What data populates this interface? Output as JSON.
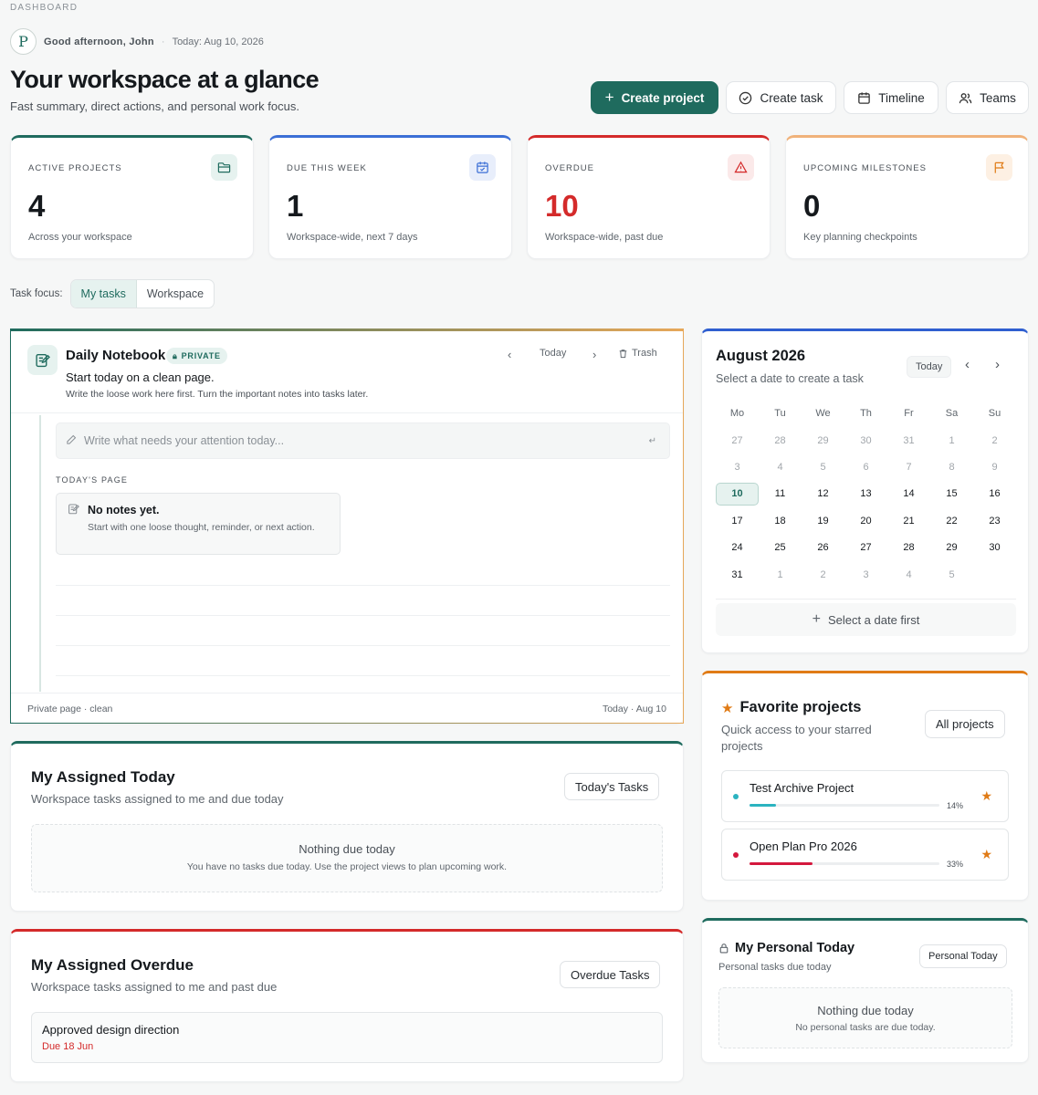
{
  "header": {
    "eyebrow": "DASHBOARD",
    "logo_letter": "P",
    "greeting": "Good afternoon, John",
    "separator": "·",
    "today": "Today: Aug 10, 2026",
    "title": "Your workspace at a glance",
    "subtitle": "Fast summary, direct actions, and personal work focus."
  },
  "actions": {
    "create_project": "Create project",
    "create_task": "Create task",
    "timeline": "Timeline",
    "teams": "Teams"
  },
  "stats": [
    {
      "label": "ACTIVE PROJECTS",
      "value": "4",
      "desc": "Across your workspace",
      "color": "#1f6b5e",
      "icon": "folder-icon"
    },
    {
      "label": "DUE THIS WEEK",
      "value": "1",
      "desc": "Workspace-wide, next 7 days",
      "color": "#3b6fd6",
      "icon": "calendar-check-icon"
    },
    {
      "label": "OVERDUE",
      "value": "10",
      "desc": "Workspace-wide, past due",
      "color": "#d42a2a",
      "icon": "alert-icon"
    },
    {
      "label": "UPCOMING MILESTONES",
      "value": "0",
      "desc": "Key planning checkpoints",
      "color": "#e07b16",
      "icon": "flag-icon"
    }
  ],
  "task_focus": {
    "label": "Task focus:",
    "options": [
      "My tasks",
      "Workspace"
    ],
    "selected": "My tasks"
  },
  "notebook": {
    "title": "Daily Notebook",
    "badge": "PRIVATE",
    "heading": "Start today on a clean page.",
    "subheading": "Write the loose work here first. Turn the important notes into tasks later.",
    "nav_today": "Today",
    "trash": "Trash",
    "placeholder": "Write what needs your attention today...",
    "return_hint": "↵",
    "section": "TODAY'S PAGE",
    "empty_title": "No notes yet.",
    "empty_desc": "Start with one loose thought, reminder, or next action.",
    "footer_left": "Private page · clean",
    "footer_right": "Today · Aug 10"
  },
  "calendar": {
    "title": "August 2026",
    "subtitle": "Select a date to create a task",
    "today_btn": "Today",
    "weekdays": [
      "Mo",
      "Tu",
      "We",
      "Th",
      "Fr",
      "Sa",
      "Su"
    ],
    "days": [
      {
        "d": "27",
        "m": true
      },
      {
        "d": "28",
        "m": true
      },
      {
        "d": "29",
        "m": true
      },
      {
        "d": "30",
        "m": true
      },
      {
        "d": "31",
        "m": true
      },
      {
        "d": "1",
        "m": true
      },
      {
        "d": "2",
        "m": true
      },
      {
        "d": "3",
        "m": true
      },
      {
        "d": "4",
        "m": true
      },
      {
        "d": "5",
        "m": true
      },
      {
        "d": "6",
        "m": true
      },
      {
        "d": "7",
        "m": true
      },
      {
        "d": "8",
        "m": true
      },
      {
        "d": "9",
        "m": true
      },
      {
        "d": "10",
        "sel": true
      },
      {
        "d": "11"
      },
      {
        "d": "12"
      },
      {
        "d": "13"
      },
      {
        "d": "14"
      },
      {
        "d": "15"
      },
      {
        "d": "16"
      },
      {
        "d": "17"
      },
      {
        "d": "18"
      },
      {
        "d": "19"
      },
      {
        "d": "20"
      },
      {
        "d": "21"
      },
      {
        "d": "22"
      },
      {
        "d": "23"
      },
      {
        "d": "24"
      },
      {
        "d": "25"
      },
      {
        "d": "26"
      },
      {
        "d": "27"
      },
      {
        "d": "28"
      },
      {
        "d": "29"
      },
      {
        "d": "30"
      },
      {
        "d": "31"
      },
      {
        "d": "1",
        "m": true
      },
      {
        "d": "2",
        "m": true
      },
      {
        "d": "3",
        "m": true
      },
      {
        "d": "4",
        "m": true
      },
      {
        "d": "5",
        "m": true
      },
      {
        "d": "",
        "m": true
      }
    ],
    "action": "Select a date first"
  },
  "assigned_today": {
    "title": "My Assigned Today",
    "subtitle": "Workspace tasks assigned to me and due today",
    "button": "Today's Tasks",
    "empty_title": "Nothing due today",
    "empty_desc": "You have no tasks due today. Use the project views to plan upcoming work."
  },
  "assigned_overdue": {
    "title": "My Assigned Overdue",
    "subtitle": "Workspace tasks assigned to me and past due",
    "button": "Overdue Tasks",
    "tasks": [
      {
        "name": "Approved design direction",
        "due": "Due 18 Jun"
      }
    ]
  },
  "favorites": {
    "title": "Favorite projects",
    "subtitle": "Quick access to your starred projects",
    "button": "All projects",
    "projects": [
      {
        "name": "Test Archive Project",
        "progress": 0.14,
        "pct_label": "14%",
        "color": "#2bb3c0"
      },
      {
        "name": "Open Plan Pro 2026",
        "progress": 0.33,
        "pct_label": "33%",
        "color": "#d4183d"
      }
    ]
  },
  "personal_today": {
    "title": "My Personal Today",
    "subtitle": "Personal tasks due today",
    "button": "Personal Today",
    "empty_title": "Nothing due today",
    "empty_desc": "No personal tasks are due today."
  },
  "colors": {
    "accent": "#1f6b5e",
    "overdue": "#d42a2a",
    "blue": "#3b6fd6",
    "orange": "#e07b16"
  }
}
